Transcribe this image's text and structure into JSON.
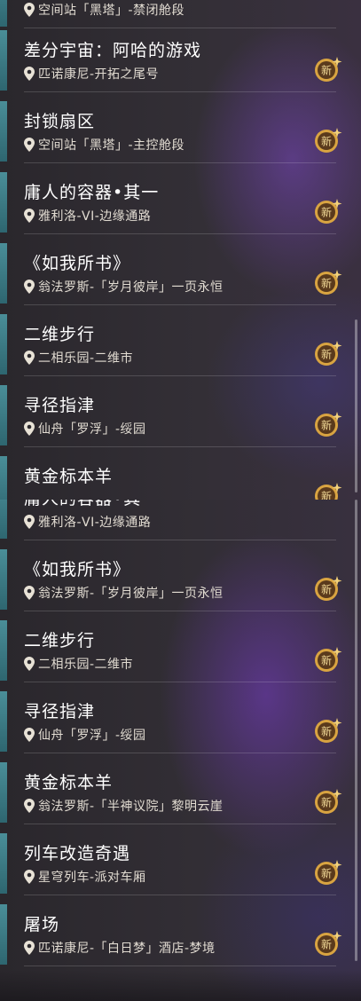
{
  "panel_top": {
    "items": [
      {
        "title": "",
        "location": "空间站「黑塔」-禁闭舱段",
        "badge": "新"
      },
      {
        "title": "差分宇宙：阿哈的游戏",
        "location": "匹诺康尼-开拓之尾号",
        "badge": "新"
      },
      {
        "title": "封锁扇区",
        "location": "空间站「黑塔」-主控舱段",
        "badge": "新"
      },
      {
        "title": "庸人的容器•其一",
        "location": "雅利洛-VI-边缘通路",
        "badge": "新"
      },
      {
        "title": "《如我所书》",
        "location": "翁法罗斯-「岁月彼岸」一页永恒",
        "badge": "新"
      },
      {
        "title": "二维步行",
        "location": "二相乐园-二维市",
        "badge": "新"
      },
      {
        "title": "寻径指津",
        "location": "仙舟「罗浮」-绥园",
        "badge": "新"
      },
      {
        "title": "黄金标本羊",
        "location": "",
        "badge": "新"
      }
    ]
  },
  "panel_bottom": {
    "items": [
      {
        "title": "庸人的容器•其",
        "location": "雅利洛-VI-边缘通路",
        "badge": ""
      },
      {
        "title": "《如我所书》",
        "location": "翁法罗斯-「岁月彼岸」一页永恒",
        "badge": "新"
      },
      {
        "title": "二维步行",
        "location": "二相乐园-二维市",
        "badge": "新"
      },
      {
        "title": "寻径指津",
        "location": "仙舟「罗浮」-绥园",
        "badge": "新"
      },
      {
        "title": "黄金标本羊",
        "location": "翁法罗斯-「半神议院」黎明云崖",
        "badge": "新"
      },
      {
        "title": "列车改造奇遇",
        "location": "星穹列车-派对车厢",
        "badge": "新"
      },
      {
        "title": "屠场",
        "location": "匹诺康尼-「白日梦」酒店-梦境",
        "badge": "新"
      }
    ]
  },
  "colors": {
    "accent_bar": "#4a8e98",
    "title_text": "#ffffff",
    "location_text": "#e2dcd2",
    "badge_gold": "#d9a441",
    "badge_inner": "#5a3a1c"
  }
}
